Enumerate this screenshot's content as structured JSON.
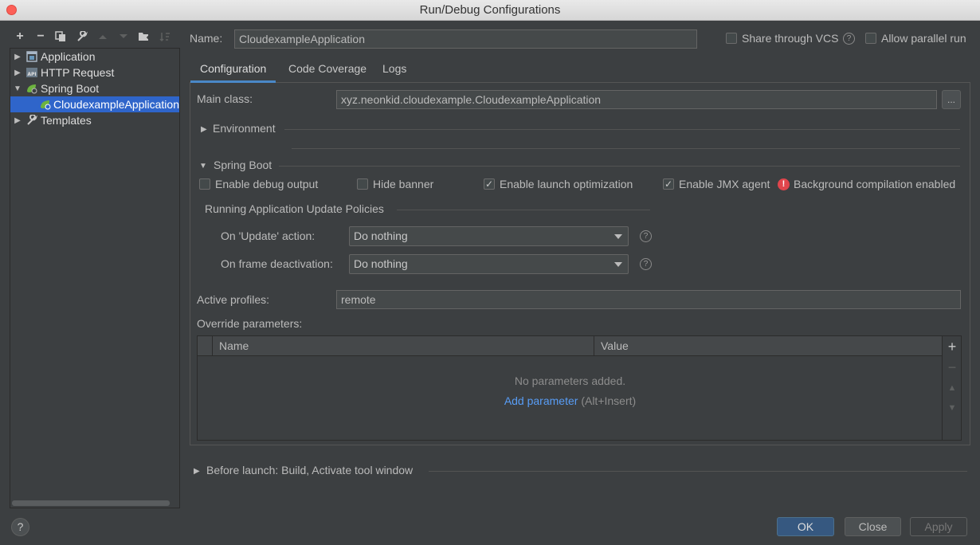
{
  "window": {
    "title": "Run/Debug Configurations"
  },
  "toolbar": {
    "icons": [
      "add-icon",
      "remove-icon",
      "copy-icon",
      "wrench-icon",
      "move-up-icon",
      "move-down-icon",
      "new-folder-icon",
      "sort-icon"
    ]
  },
  "tree": {
    "items": [
      {
        "label": "Application",
        "expanded": false,
        "icon": "application-icon"
      },
      {
        "label": "HTTP Request",
        "expanded": false,
        "icon": "api-icon"
      },
      {
        "label": "Spring Boot",
        "expanded": true,
        "icon": "spring-boot-icon"
      },
      {
        "label": "CloudexampleApplication",
        "selected": true,
        "icon": "spring-boot-icon"
      },
      {
        "label": "Templates",
        "expanded": false,
        "icon": "wrench-icon"
      }
    ]
  },
  "header": {
    "name_label": "Name:",
    "name_value": "CloudexampleApplication",
    "share_vcs_label": "Share through VCS",
    "share_vcs_checked": false,
    "allow_parallel_label": "Allow parallel run",
    "allow_parallel_checked": false
  },
  "tabs": [
    {
      "label": "Configuration",
      "active": true
    },
    {
      "label": "Code Coverage",
      "active": false
    },
    {
      "label": "Logs",
      "active": false
    }
  ],
  "config": {
    "main_class_label": "Main class:",
    "main_class_value": "xyz.neonkid.cloudexample.CloudexampleApplication",
    "browse_label": "...",
    "environment_label": "Environment",
    "spring_boot_label": "Spring Boot",
    "enable_debug_label": "Enable debug output",
    "enable_debug_checked": false,
    "hide_banner_label": "Hide banner",
    "hide_banner_checked": false,
    "launch_opt_label": "Enable launch optimization",
    "launch_opt_checked": true,
    "jmx_label": "Enable JMX agent",
    "jmx_checked": true,
    "bg_compilation_label": "Background compilation enabled",
    "update_policies_label": "Running Application Update Policies",
    "on_update_label": "On 'Update' action:",
    "on_update_value": "Do nothing",
    "on_frame_label": "On frame deactivation:",
    "on_frame_value": "Do nothing",
    "active_profiles_label": "Active profiles:",
    "active_profiles_value": "remote",
    "override_label": "Override parameters:",
    "table": {
      "columns": [
        "Name",
        "Value"
      ],
      "empty_text": "No parameters added.",
      "add_link": "Add parameter",
      "add_shortcut": "(Alt+Insert)"
    },
    "before_launch_label": "Before launch: Build, Activate tool window"
  },
  "footer": {
    "help_label": "?",
    "ok_label": "OK",
    "close_label": "Close",
    "apply_label": "Apply"
  },
  "colors": {
    "background": "#3c3f41",
    "selection": "#2f65ca",
    "accent": "#4a88c7",
    "link": "#589df6",
    "error": "#e0454c"
  }
}
